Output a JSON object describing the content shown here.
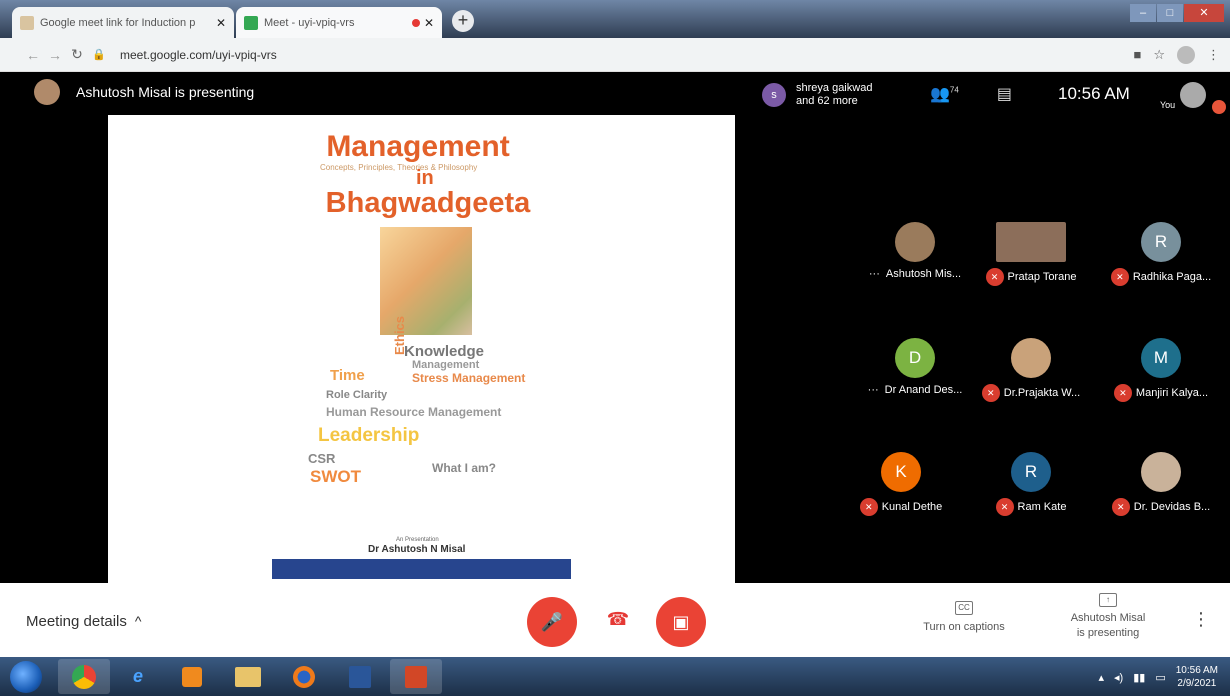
{
  "browser": {
    "tabs": [
      {
        "title": "Google meet link for Induction p",
        "active": true
      },
      {
        "title": "Meet - uyi-vpiq-vrs",
        "active": false
      }
    ],
    "url": "meet.google.com/uyi-vpiq-vrs"
  },
  "meet": {
    "presenting_banner": "Ashutosh Misal is presenting",
    "viewer_initial": "s",
    "viewer_name": "shreya gaikwad",
    "viewer_more": "and 62 more",
    "participant_count": "74",
    "time": "10:56 AM",
    "you_label": "You"
  },
  "slide": {
    "title_line1": "Management",
    "subtitle": "Concepts, Principles, Theories & Philosophy",
    "title_in": "in",
    "title_line2": "Bhagwadgeeta",
    "words": [
      {
        "text": "Knowledge",
        "color": "#777"
      },
      {
        "text": "Management",
        "color": "#999"
      },
      {
        "text": "Time",
        "color": "#f0a04b"
      },
      {
        "text": "Stress Management",
        "color": "#e8894a"
      },
      {
        "text": "Role Clarity",
        "color": "#888"
      },
      {
        "text": "Ethics",
        "color": "#e8894a"
      },
      {
        "text": "Human Resource Management",
        "color": "#999"
      },
      {
        "text": "Leadership",
        "color": "#f4c542"
      },
      {
        "text": "CSR",
        "color": "#888"
      },
      {
        "text": "What I am?",
        "color": "#888"
      },
      {
        "text": "SWOT",
        "color": "#f08a3e"
      }
    ],
    "author_small": "An Presentation",
    "author": "Dr Ashutosh N Misal"
  },
  "participants": [
    {
      "name": "Ashutosh Mis...",
      "initial": "",
      "color": "#9a7b5c",
      "muted": false
    },
    {
      "name": "Pratap Torane",
      "initial": "",
      "color": "#8c6e5a",
      "muted": true
    },
    {
      "name": "Radhika Paga...",
      "initial": "R",
      "color": "#78909c",
      "muted": true
    },
    {
      "name": "Dr Anand Des...",
      "initial": "D",
      "color": "#7cb342",
      "muted": false
    },
    {
      "name": "Dr.Prajakta W...",
      "initial": "",
      "color": "#c9a27a",
      "muted": true
    },
    {
      "name": "Manjiri Kalya...",
      "initial": "M",
      "color": "#1e6f8c",
      "muted": true
    },
    {
      "name": "Kunal Dethe",
      "initial": "K",
      "color": "#ef6c00",
      "muted": true
    },
    {
      "name": "Ram Kate",
      "initial": "R",
      "color": "#1e5f8c",
      "muted": true
    },
    {
      "name": "Dr. Devidas B...",
      "initial": "",
      "color": "#c9b29a",
      "muted": true
    }
  ],
  "bottombar": {
    "meeting_details": "Meeting details",
    "captions": "Turn on captions",
    "presenting_line1": "Ashutosh Misal",
    "presenting_line2": "is presenting"
  },
  "taskbar": {
    "time": "10:56 AM",
    "date": "2/9/2021"
  },
  "colors": {
    "accent_red": "#ea4335",
    "meet_bg": "#000000",
    "slide_title": "#e3612a"
  }
}
